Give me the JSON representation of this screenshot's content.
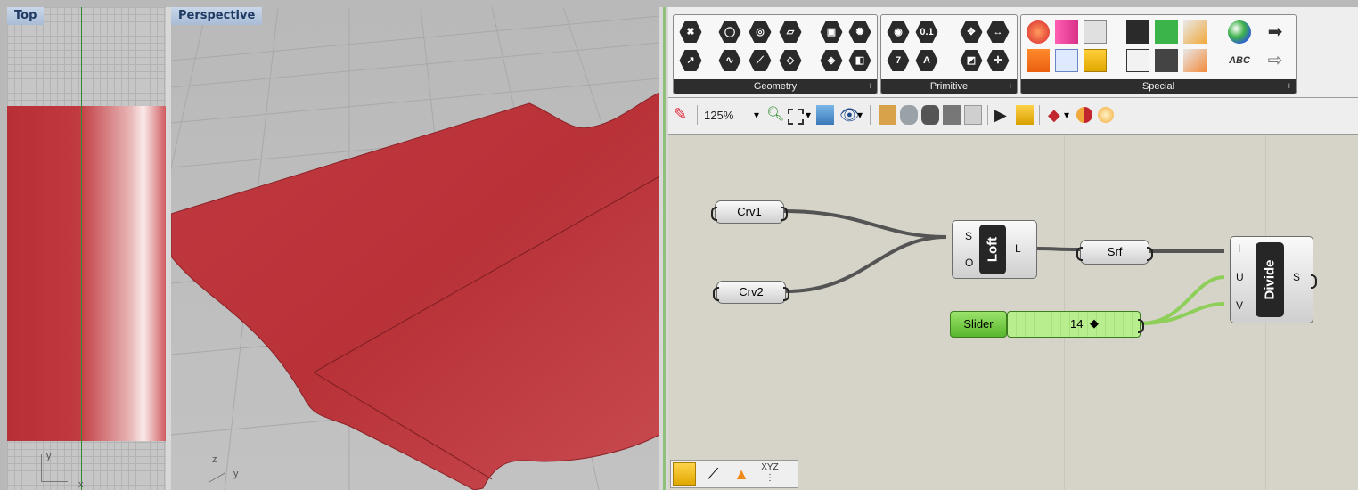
{
  "viewports": {
    "top": {
      "label": "Top",
      "axis_y": "y",
      "axis_x": "x"
    },
    "perspective": {
      "label": "Perspective",
      "axis_z": "z",
      "axis_y": "y"
    }
  },
  "tabs": {
    "panels": [
      {
        "title": "Geometry"
      },
      {
        "title": "Primitive"
      },
      {
        "title": "Special"
      }
    ],
    "primitive_icon_text": [
      "0.1",
      "A"
    ],
    "special_icon_text": "ABC"
  },
  "toolbar": {
    "zoom": "125%"
  },
  "canvas": {
    "crv1": "Crv1",
    "crv2": "Crv2",
    "loft": {
      "title": "Loft",
      "in1": "S",
      "in2": "O",
      "out": "L"
    },
    "srf": "Srf",
    "slider": {
      "label": "Slider",
      "value": "14"
    },
    "divide": {
      "title": "Divide",
      "in1": "I",
      "in2": "U",
      "in3": "V",
      "out": "S"
    }
  },
  "colors": {
    "surface_red": "#c73a3f",
    "wire": "#545454",
    "wire_green": "#8ecf5a",
    "slider_green": "#6ec53a",
    "label_blue": "#1f3a63"
  }
}
